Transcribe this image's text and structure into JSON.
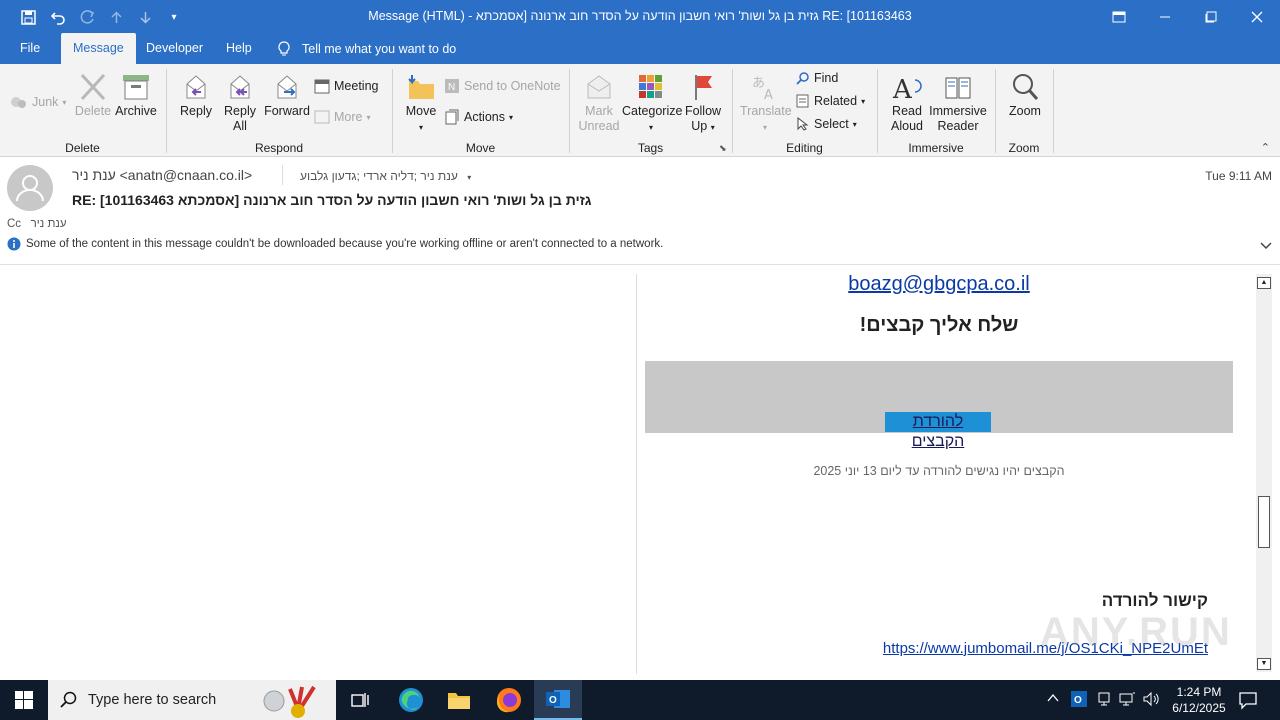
{
  "window": {
    "title": "RE: [101163463 גזית בן גל ושות' רואי חשבון הודעה על הסדר חוב ארנונה [אסמכתא - Message (HTML)"
  },
  "menu": {
    "tabs": [
      "File",
      "Message",
      "Developer",
      "Help"
    ],
    "tell_me": "Tell me what you want to do"
  },
  "ribbon": {
    "junk": "Junk",
    "delete": "Delete",
    "archive": "Archive",
    "group_delete": "Delete",
    "reply": "Reply",
    "reply_all_1": "Reply",
    "reply_all_2": "All",
    "forward": "Forward",
    "meeting": "Meeting",
    "more": "More",
    "group_respond": "Respond",
    "move": "Move",
    "send_onenote": "Send to OneNote",
    "actions": "Actions",
    "group_move": "Move",
    "mark_unread_1": "Mark",
    "mark_unread_2": "Unread",
    "categorize": "Categorize",
    "follow_up_1": "Follow",
    "follow_up_2": "Up",
    "group_tags": "Tags",
    "translate": "Translate",
    "find": "Find",
    "related": "Related",
    "select": "Select",
    "group_editing": "Editing",
    "read_aloud_1": "Read",
    "read_aloud_2": "Aloud",
    "immersive_1": "Immersive",
    "immersive_2": "Reader",
    "group_immersive": "Immersive",
    "zoom": "Zoom",
    "group_zoom": "Zoom"
  },
  "message": {
    "from": "ענת ניר <anatn@cnaan.co.il>",
    "to": "ענת ניר ;דליה ארדי ;גדעון גלבוע",
    "subject": "RE: [101163463 גזית בן גל ושות' רואי חשבון הודעה על הסדר חוב ארנונה [אסמכתא",
    "time": "Tue 9:11 AM",
    "cc_label": "Cc",
    "cc_value": "ענת ניר",
    "info": "Some of the content in this message couldn't be downloaded because you're working offline or aren't connected to a network."
  },
  "body": {
    "email_link": "boazg@gbgcpa.co.il",
    "heading": "שלח אליך קבצים!",
    "download_button": "להורדת הקבצים",
    "availability": "הקבצים יהיו נגישים להורדה עד ליום 13 יוני 2025",
    "link_heading": "קישור להורדה",
    "download_url": "https://www.jumbomail.me/j/OS1CKi_NPE2UmEt",
    "watermark": "ANY.RUN"
  },
  "taskbar": {
    "search_placeholder": "Type here to search",
    "time": "1:24 PM",
    "date": "6/12/2025"
  },
  "colors": {
    "accent": "#2b6fc6",
    "link": "#0b3aa8",
    "taskbar": "#0f1a2b",
    "download_bg": "#c8c8c8",
    "highlight": "#1e90d6"
  }
}
